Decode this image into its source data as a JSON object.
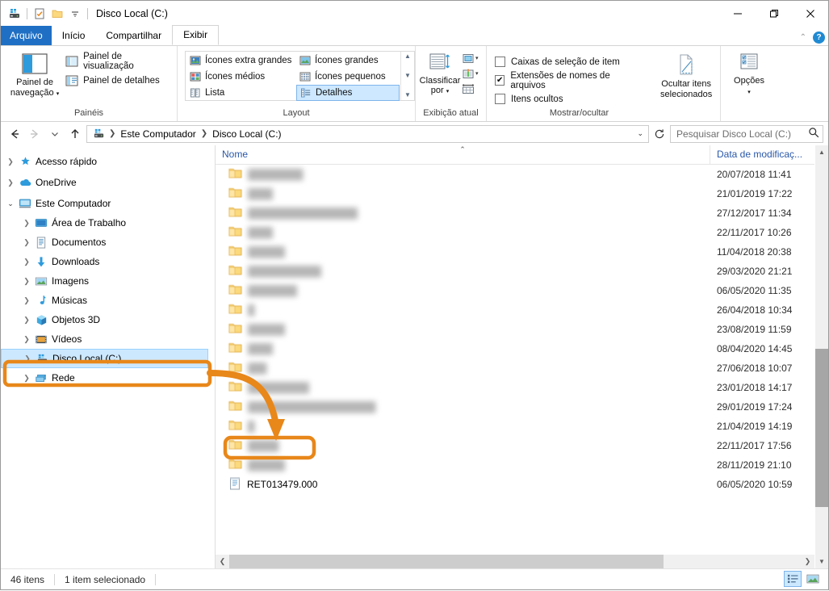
{
  "window": {
    "title": "Disco Local (C:)",
    "quick_access": [
      "drive-icon",
      "properties-icon",
      "new-folder-icon",
      "customize-dropdown-icon"
    ],
    "controls": {
      "minimize": "—",
      "maximize": "❐",
      "close": "✕"
    }
  },
  "tabs": [
    {
      "label": "Arquivo",
      "style": "file"
    },
    {
      "label": "Início",
      "style": "normal"
    },
    {
      "label": "Compartilhar",
      "style": "normal"
    },
    {
      "label": "Exibir",
      "style": "active"
    }
  ],
  "ribbon": {
    "collapse_label": "⌃",
    "help_label": "?",
    "groups": [
      {
        "name": "Painéis",
        "label": "Painéis",
        "big_button": {
          "line1": "Painel de",
          "line2": "navegação"
        },
        "small_buttons": [
          {
            "label": "Painel de visualização"
          },
          {
            "label": "Painel de detalhes"
          }
        ]
      },
      {
        "name": "Layout",
        "label": "Layout",
        "gallery": [
          {
            "label": "Ícones extra grandes",
            "selected": false
          },
          {
            "label": "Ícones grandes",
            "selected": false
          },
          {
            "label": "Ícones médios",
            "selected": false
          },
          {
            "label": "Ícones pequenos",
            "selected": false
          },
          {
            "label": "Lista",
            "selected": false
          },
          {
            "label": "Detalhes",
            "selected": true
          }
        ]
      },
      {
        "name": "Exibição atual",
        "label": "Exibição atual",
        "sort_button": {
          "line1": "Classificar",
          "line2": "por"
        }
      },
      {
        "name": "Mostrar/ocultar",
        "label": "Mostrar/ocultar",
        "checkboxes": [
          {
            "label": "Caixas de seleção de item",
            "checked": false
          },
          {
            "label": "Extensões de nomes de arquivos",
            "checked": true
          },
          {
            "label": "Itens ocultos",
            "checked": false
          }
        ],
        "hide_button": {
          "line1": "Ocultar itens",
          "line2": "selecionados"
        }
      },
      {
        "name": "Opções",
        "label": "",
        "options_button": {
          "line1": "Opções",
          "line2": ""
        }
      }
    ]
  },
  "address_bar": {
    "back": "←",
    "forward": "→",
    "recent": "⌄",
    "up": "↑",
    "breadcrumbs": [
      "Este Computador",
      "Disco Local (C:)"
    ],
    "dropdown_caret": "⌄",
    "refresh": "↻"
  },
  "search": {
    "placeholder": "Pesquisar Disco Local (C:)",
    "icon": "search-icon"
  },
  "sidebar": {
    "items": [
      {
        "label": "Acesso rápido",
        "icon": "star-icon",
        "level": 0,
        "expanded": false,
        "selected": false
      },
      {
        "label": "OneDrive",
        "icon": "cloud-icon",
        "level": 0,
        "expanded": false,
        "selected": false
      },
      {
        "label": "Este Computador",
        "icon": "computer-icon",
        "level": 0,
        "expanded": true,
        "selected": false
      },
      {
        "label": "Área de Trabalho",
        "icon": "desktop-icon",
        "level": 1,
        "expanded": false,
        "selected": false
      },
      {
        "label": "Documentos",
        "icon": "documents-icon",
        "level": 1,
        "expanded": false,
        "selected": false
      },
      {
        "label": "Downloads",
        "icon": "download-icon",
        "level": 1,
        "expanded": false,
        "selected": false
      },
      {
        "label": "Imagens",
        "icon": "pictures-icon",
        "level": 1,
        "expanded": false,
        "selected": false
      },
      {
        "label": "Músicas",
        "icon": "music-icon",
        "level": 1,
        "expanded": false,
        "selected": false
      },
      {
        "label": "Objetos 3D",
        "icon": "objects3d-icon",
        "level": 1,
        "expanded": false,
        "selected": false
      },
      {
        "label": "Vídeos",
        "icon": "videos-icon",
        "level": 1,
        "expanded": false,
        "selected": false
      },
      {
        "label": "Disco Local (C:)",
        "icon": "drive-icon",
        "level": 1,
        "expanded": false,
        "selected": true
      },
      {
        "label": "Rede",
        "icon": "network-icon",
        "level": 0,
        "expanded": false,
        "selected": false
      }
    ]
  },
  "file_list": {
    "columns": [
      {
        "label": "Nome",
        "sort": "asc"
      },
      {
        "label": "Data de modificaç...",
        "sort": ""
      }
    ],
    "rows": [
      {
        "name": "",
        "blurred": true,
        "type": "folder",
        "date": "20/07/2018 11:41",
        "blur_width": 82
      },
      {
        "name": "",
        "blurred": true,
        "type": "folder",
        "date": "21/01/2019 17:22",
        "blur_width": 40
      },
      {
        "name": "",
        "blurred": true,
        "type": "folder",
        "date": "27/12/2017 11:34",
        "blur_width": 162
      },
      {
        "name": "",
        "blurred": true,
        "type": "folder",
        "date": "22/11/2017 10:26",
        "blur_width": 36
      },
      {
        "name": "",
        "blurred": true,
        "type": "folder",
        "date": "11/04/2018 20:38",
        "blur_width": 52
      },
      {
        "name": "",
        "blurred": true,
        "type": "folder",
        "date": "29/03/2020 21:21",
        "blur_width": 110
      },
      {
        "name": "",
        "blurred": true,
        "type": "folder",
        "date": "06/05/2020 11:35",
        "blur_width": 68
      },
      {
        "name": "",
        "blurred": true,
        "type": "folder",
        "date": "26/04/2018 10:34",
        "blur_width": 10
      },
      {
        "name": "",
        "blurred": true,
        "type": "folder",
        "date": "23/08/2019 11:59",
        "blur_width": 56
      },
      {
        "name": "",
        "blurred": true,
        "type": "folder",
        "date": "08/04/2020 14:45",
        "blur_width": 34
      },
      {
        "name": "",
        "blurred": true,
        "type": "folder",
        "date": "27/06/2018 10:07",
        "blur_width": 26
      },
      {
        "name": "",
        "blurred": true,
        "type": "folder",
        "date": "23/01/2018 14:17",
        "blur_width": 92
      },
      {
        "name": "",
        "blurred": true,
        "type": "folder",
        "date": "29/01/2019 17:24",
        "blur_width": 188
      },
      {
        "name": "",
        "blurred": true,
        "type": "folder",
        "date": "21/04/2019 14:19",
        "blur_width": 12
      },
      {
        "name": "",
        "blurred": true,
        "type": "folder",
        "date": "22/11/2017 17:56",
        "blur_width": 46
      },
      {
        "name": "",
        "blurred": true,
        "type": "folder",
        "date": "28/11/2019 21:10",
        "blur_width": 50
      },
      {
        "name": "RET013479.000",
        "blurred": false,
        "type": "file",
        "date": "06/05/2020 10:59",
        "blur_width": 0
      }
    ]
  },
  "status_bar": {
    "item_count": "46 itens",
    "selection": "1 item selecionado",
    "view_details": "details-view-icon",
    "view_large": "large-icons-view-icon"
  },
  "annotation": {
    "color": "#E8871A",
    "highlight_sidebar_item": "Disco Local (C:)",
    "highlight_file": "RET013479.000",
    "arrow": "curved-arrow"
  }
}
